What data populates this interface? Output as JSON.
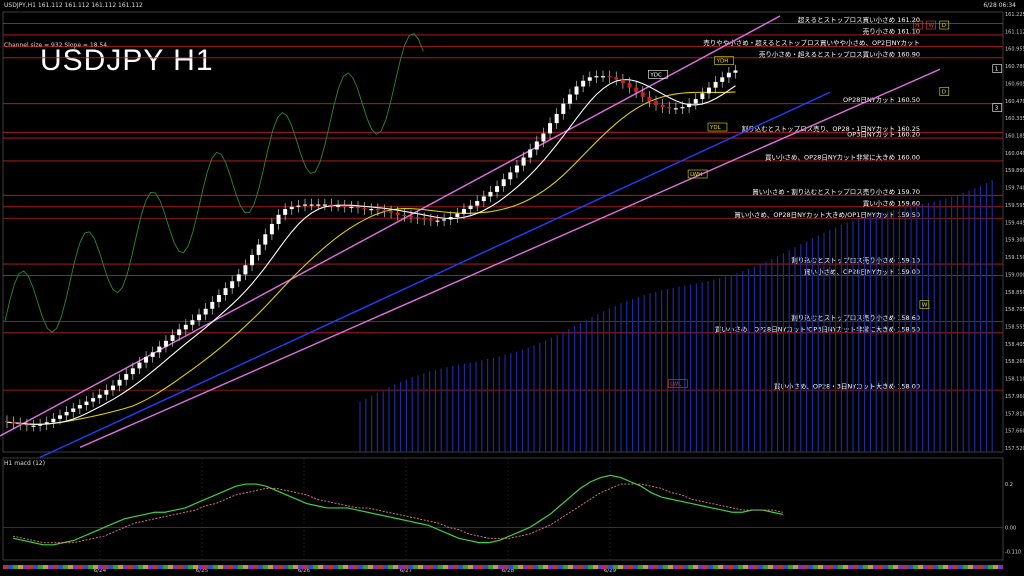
{
  "header": {
    "symbol_line": "USDJPY,H1  161.112 161.112 161.112 161.112",
    "timestamp": "6/28 06:34",
    "channel_info": "Channel size = 932  Slope = 18.54"
  },
  "title": "USDJPY H1",
  "macd_label": "H1  macd (12)",
  "chart_data": {
    "type": "line",
    "price_range": [
      157.46,
      161.3
    ],
    "y_ticks": [
      "161.225",
      "161.112",
      "160.955",
      "160.780",
      "160.605",
      "160.470",
      "160.335",
      "160.185",
      "160.040",
      "159.890",
      "159.740",
      "159.595",
      "159.445",
      "159.300",
      "159.150",
      "159.000",
      "158.850",
      "158.705",
      "158.555",
      "158.405",
      "158.260",
      "158.110",
      "157.960",
      "157.810",
      "157.660",
      "157.520"
    ],
    "x_labels": [
      "6/24",
      "6/25",
      "6/26",
      "6/27",
      "6/28",
      "6/29"
    ],
    "levels": [
      {
        "price": 161.2,
        "label": "超えるとストップロス買い小さめ 161.20",
        "color": "#c02020"
      },
      {
        "price": 161.1,
        "label": "売り小さめ 161.10",
        "color": "#c02020"
      },
      {
        "price": 161.0,
        "label": "売りやや小さめ・超えるとストップロス買いやや小さめ、OP2日NYカット",
        "color": "#c02020"
      },
      {
        "price": 160.9,
        "label": "売り小さめ・超えるとストップロス買い小さめ 160.90",
        "color": "#c02020"
      },
      {
        "price": 160.5,
        "label": "OP28日NYカット 160.50",
        "color": "#c02020"
      },
      {
        "price": 160.25,
        "label": "割り込むとストップロス売り、OP28・1日NYカット 160.25",
        "color": "#c02020"
      },
      {
        "price": 160.2,
        "label": "OP3日NYカット 160.20",
        "color": "#c02020"
      },
      {
        "price": 160.0,
        "label": "買い小さめ、OP28日NYカット非常に大きめ 160.00",
        "color": "#c02020"
      },
      {
        "price": 159.7,
        "label": "買い小さめ・割り込むとストップロス売り小さめ 159.70",
        "color": "#c02020"
      },
      {
        "price": 159.6,
        "label": "買い小さめ 159.60",
        "color": "#c02020"
      },
      {
        "price": 159.5,
        "label": "買い小さめ、OP28日NYカット大きめ/OP1日NYカット 159.50",
        "color": "#c02020"
      },
      {
        "price": 159.1,
        "label": "割り込むとストップロス売り小さめ 159.10",
        "color": "#c02020"
      },
      {
        "price": 159.0,
        "label": "買い小さめ、OP28日NYカット 159.00",
        "color": "#c02020"
      },
      {
        "price": 158.6,
        "label": "割り込むとストップロス売り小さめ 158.60",
        "color": "#c02020"
      },
      {
        "price": 158.5,
        "label": "買い小さめ、OP28日NYカット/OP3日NYカット非常に大きめ 158.50",
        "color": "#c02020"
      },
      {
        "price": 158.0,
        "label": "買い小さめ、OP28・3日NYカット大きめ 158.00",
        "color": "#c02020"
      }
    ],
    "tags": [
      {
        "text": "YDH",
        "price": 160.85,
        "bar": 107,
        "color": "#e0e000"
      },
      {
        "text": "YDC",
        "price": 160.73,
        "bar": 97,
        "color": "#ffffff"
      },
      {
        "text": "YDL",
        "price": 160.27,
        "bar": 106,
        "color": "#e0e000"
      },
      {
        "text": "LWH",
        "price": 159.86,
        "bar": 103,
        "color": "#e0e000"
      },
      {
        "text": "LWL",
        "price": 158.03,
        "bar": 100,
        "color": "#e04040"
      },
      {
        "text": "W",
        "price": 158.72,
        "bar": 138,
        "color": "#e0e000"
      },
      {
        "text": "H",
        "price": 161.16,
        "bar": 137,
        "color": "#e04040"
      },
      {
        "text": "W",
        "price": 161.16,
        "bar": 139,
        "color": "#e04040"
      },
      {
        "text": "D",
        "price": 161.16,
        "bar": 141,
        "color": "#e0e000"
      },
      {
        "text": "D",
        "price": 160.58,
        "bar": 141,
        "color": "#e0e000"
      },
      {
        "text": "1",
        "price": 160.78,
        "bar": 149,
        "color": "#ffffff"
      },
      {
        "text": "3",
        "price": 160.44,
        "bar": 149,
        "color": "#ffffff"
      }
    ],
    "candles": [
      [
        157.73,
        157.72
      ],
      [
        157.72,
        157.71
      ],
      [
        157.71,
        157.7
      ],
      [
        157.7,
        157.69
      ],
      [
        157.69,
        157.69
      ],
      [
        157.69,
        157.7
      ],
      [
        157.7,
        157.72
      ],
      [
        157.72,
        157.75
      ],
      [
        157.75,
        157.78
      ],
      [
        157.78,
        157.81
      ],
      [
        157.81,
        157.84
      ],
      [
        157.84,
        157.87
      ],
      [
        157.87,
        157.9
      ],
      [
        157.9,
        157.93
      ],
      [
        157.93,
        157.96
      ],
      [
        157.96,
        158.0
      ],
      [
        158.0,
        158.04
      ],
      [
        158.04,
        158.09
      ],
      [
        158.09,
        158.14
      ],
      [
        158.14,
        158.19
      ],
      [
        158.19,
        158.24
      ],
      [
        158.24,
        158.29
      ],
      [
        158.29,
        158.33
      ],
      [
        158.33,
        158.38
      ],
      [
        158.38,
        158.43
      ],
      [
        158.43,
        158.48
      ],
      [
        158.48,
        158.53
      ],
      [
        158.53,
        158.57
      ],
      [
        158.57,
        158.61
      ],
      [
        158.61,
        158.66
      ],
      [
        158.66,
        158.71
      ],
      [
        158.71,
        158.77
      ],
      [
        158.77,
        158.83
      ],
      [
        158.83,
        158.89
      ],
      [
        158.89,
        158.95
      ],
      [
        158.95,
        159.01
      ],
      [
        159.01,
        159.09
      ],
      [
        159.09,
        159.18
      ],
      [
        159.18,
        159.27
      ],
      [
        159.27,
        159.36
      ],
      [
        159.36,
        159.45
      ],
      [
        159.45,
        159.53
      ],
      [
        159.53,
        159.58
      ],
      [
        159.58,
        159.6
      ],
      [
        159.6,
        159.61
      ],
      [
        159.61,
        159.62
      ],
      [
        159.62,
        159.62
      ],
      [
        159.62,
        159.62
      ],
      [
        159.62,
        159.62
      ],
      [
        159.62,
        159.61
      ],
      [
        159.61,
        159.61
      ],
      [
        159.61,
        159.6
      ],
      [
        159.6,
        159.6
      ],
      [
        159.6,
        159.59
      ],
      [
        159.59,
        159.58
      ],
      [
        159.58,
        159.58
      ],
      [
        159.58,
        159.57
      ],
      [
        159.57,
        159.56
      ],
      [
        159.56,
        159.55
      ],
      [
        159.55,
        159.53
      ],
      [
        159.53,
        159.52
      ],
      [
        159.52,
        159.51
      ],
      [
        159.51,
        159.5
      ],
      [
        159.5,
        159.49
      ],
      [
        159.49,
        159.48
      ],
      [
        159.48,
        159.48
      ],
      [
        159.48,
        159.49
      ],
      [
        159.49,
        159.51
      ],
      [
        159.51,
        159.54
      ],
      [
        159.54,
        159.58
      ],
      [
        159.58,
        159.61
      ],
      [
        159.61,
        159.65
      ],
      [
        159.65,
        159.69
      ],
      [
        159.69,
        159.73
      ],
      [
        159.73,
        159.78
      ],
      [
        159.78,
        159.84
      ],
      [
        159.84,
        159.9
      ],
      [
        159.9,
        159.96
      ],
      [
        159.96,
        160.03
      ],
      [
        160.03,
        160.1
      ],
      [
        160.1,
        160.17
      ],
      [
        160.17,
        160.24
      ],
      [
        160.24,
        160.33
      ],
      [
        160.33,
        160.41
      ],
      [
        160.41,
        160.5
      ],
      [
        160.5,
        160.58
      ],
      [
        160.58,
        160.65
      ],
      [
        160.65,
        160.7
      ],
      [
        160.7,
        160.73
      ],
      [
        160.73,
        160.74
      ],
      [
        160.74,
        160.74
      ],
      [
        160.74,
        160.73
      ],
      [
        160.73,
        160.71
      ],
      [
        160.71,
        160.68
      ],
      [
        160.68,
        160.64
      ],
      [
        160.64,
        160.6
      ],
      [
        160.6,
        160.56
      ],
      [
        160.56,
        160.52
      ],
      [
        160.52,
        160.49
      ],
      [
        160.49,
        160.47
      ],
      [
        160.47,
        160.46
      ],
      [
        160.46,
        160.46
      ],
      [
        160.46,
        160.47
      ],
      [
        160.47,
        160.5
      ],
      [
        160.5,
        160.54
      ],
      [
        160.54,
        160.59
      ],
      [
        160.59,
        160.64
      ],
      [
        160.64,
        160.69
      ],
      [
        160.69,
        160.73
      ],
      [
        160.73,
        160.77
      ],
      [
        160.77,
        160.79
      ]
    ],
    "macd": {
      "y_range": [
        -0.15,
        0.32
      ],
      "labels": [
        "0.2",
        "0.00",
        "-0.110"
      ],
      "main": [
        -0.05,
        -0.06,
        -0.07,
        -0.08,
        -0.08,
        -0.07,
        -0.06,
        -0.04,
        -0.02,
        0.0,
        0.02,
        0.04,
        0.05,
        0.06,
        0.07,
        0.07,
        0.08,
        0.09,
        0.11,
        0.13,
        0.15,
        0.17,
        0.19,
        0.2,
        0.2,
        0.19,
        0.17,
        0.15,
        0.13,
        0.11,
        0.1,
        0.09,
        0.09,
        0.09,
        0.08,
        0.07,
        0.06,
        0.05,
        0.04,
        0.03,
        0.02,
        0.01,
        -0.01,
        -0.03,
        -0.05,
        -0.06,
        -0.07,
        -0.07,
        -0.06,
        -0.04,
        -0.02,
        0.0,
        0.03,
        0.06,
        0.1,
        0.14,
        0.18,
        0.21,
        0.23,
        0.24,
        0.23,
        0.21,
        0.19,
        0.16,
        0.14,
        0.13,
        0.12,
        0.11,
        0.1,
        0.09,
        0.08,
        0.07,
        0.07,
        0.08,
        0.08,
        0.07,
        0.06
      ],
      "signal": [
        -0.04,
        -0.05,
        -0.06,
        -0.07,
        -0.07,
        -0.07,
        -0.07,
        -0.06,
        -0.05,
        -0.04,
        -0.02,
        0.0,
        0.02,
        0.03,
        0.04,
        0.05,
        0.06,
        0.07,
        0.08,
        0.1,
        0.11,
        0.13,
        0.15,
        0.16,
        0.17,
        0.18,
        0.18,
        0.17,
        0.16,
        0.15,
        0.13,
        0.12,
        0.11,
        0.1,
        0.09,
        0.09,
        0.08,
        0.07,
        0.06,
        0.05,
        0.04,
        0.03,
        0.02,
        0.0,
        -0.01,
        -0.03,
        -0.04,
        -0.05,
        -0.05,
        -0.05,
        -0.04,
        -0.03,
        -0.01,
        0.01,
        0.04,
        0.07,
        0.1,
        0.13,
        0.16,
        0.18,
        0.2,
        0.2,
        0.2,
        0.19,
        0.18,
        0.16,
        0.15,
        0.13,
        0.12,
        0.11,
        0.1,
        0.09,
        0.08,
        0.08,
        0.08,
        0.08,
        0.07
      ]
    }
  }
}
